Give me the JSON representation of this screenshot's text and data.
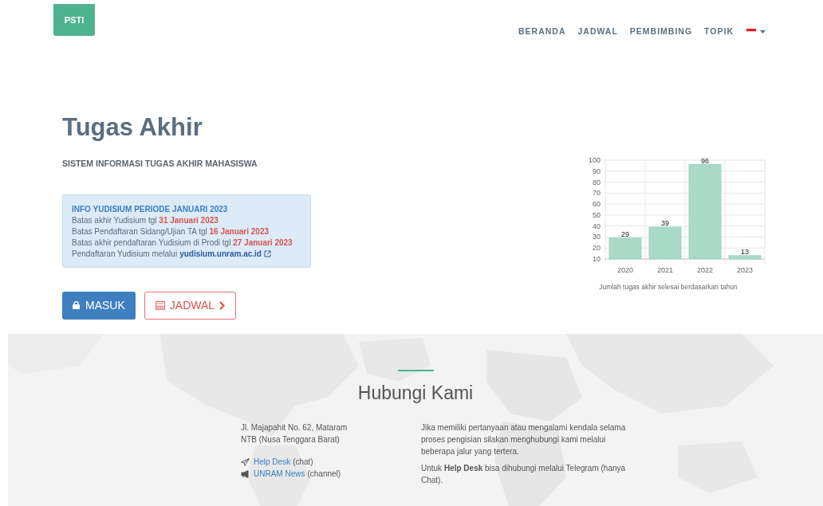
{
  "brand": "PSTI",
  "nav": [
    {
      "label": "BERANDA"
    },
    {
      "label": "JADWAL"
    },
    {
      "label": "PEMBIMBING"
    },
    {
      "label": "TOPIK"
    }
  ],
  "hero": {
    "title": "Tugas Akhir",
    "subtitle": "SISTEM INFORMASI TUGAS AKHIR MAHASISWA"
  },
  "info": {
    "title": "INFO YUDISIUM PERIODE JANUARI 2023",
    "lines": [
      {
        "kind": "text",
        "text": "Batas akhir Yudisium tgl **31 Januari 2023**"
      },
      {
        "kind": "text",
        "text": "Batas Pendaftaran Sidang/Ujian TA tgl **16 Januari 2023**"
      },
      {
        "kind": "text",
        "text": "Batas akhir pendaftaran Yudisium di Prodi tgl **27 Januari 2023**"
      },
      {
        "kind": "link",
        "text": "Pendaftaran Yudisium melalui",
        "link": "yudisium.unram.ac.id"
      }
    ]
  },
  "buttons": [
    {
      "label": "MASUK",
      "kind": "primary"
    },
    {
      "label": "JADWAL",
      "kind": "outline"
    }
  ],
  "chart": {
    "caption": "Jumlah tugas akhir selesai berdasarkan tahun",
    "chart_data": {
      "type": "bar",
      "categories": [
        "2020",
        "2021",
        "2022",
        "2023"
      ],
      "values": [
        29,
        39,
        96,
        13
      ],
      "ylim": [
        10,
        100
      ],
      "yticks": [
        10,
        20,
        30,
        40,
        50,
        60,
        70,
        80,
        90,
        100
      ],
      "data_labels": true,
      "grid": true
    }
  },
  "contact": {
    "title": "Hubungi Kami",
    "address": [
      "Jl. Majapahit No. 62, Mataram",
      "NTB (Nusa Tenggara Barat)"
    ],
    "links": [
      {
        "kind": "chat",
        "label": "Help Desk",
        "note": "(chat)"
      },
      {
        "kind": "channel",
        "label": "UNRAM News",
        "note": "(channel)"
      }
    ],
    "paragraphs": [
      "Jika memiliki pertanyaan atau mengalami kendala selama proses pengisian silakan menghubungi kami melalui beberapa jalur yang tertera.",
      "Untuk **Help Desk** bisa dihubungi melalui Telegram (hanya Chat)."
    ]
  }
}
